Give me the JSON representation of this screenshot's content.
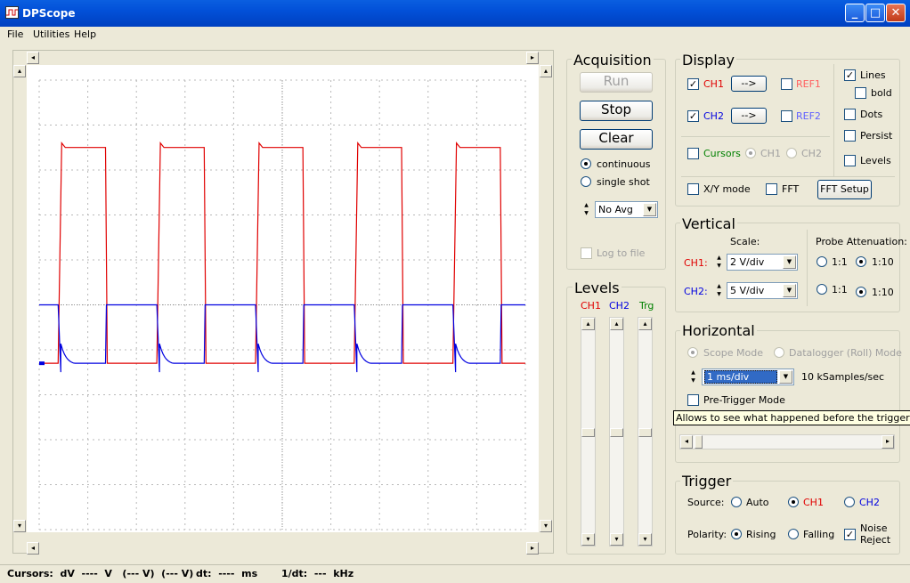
{
  "window": {
    "title": "DPScope",
    "min": "_",
    "max": "□",
    "close": "✕"
  },
  "menu": [
    "File",
    "Utilities",
    "Help"
  ],
  "acquisition": {
    "title": "Acquisition",
    "run": "Run",
    "stop": "Stop",
    "clear": "Clear",
    "continuous": "continuous",
    "single_shot": "single shot",
    "avg": "No Avg",
    "log": "Log to file"
  },
  "display": {
    "title": "Display",
    "ch1": "CH1",
    "ch2": "CH2",
    "ref1": "REF1",
    "ref2": "REF2",
    "arrow": "-->",
    "cursors": "Cursors",
    "cur_ch1": "CH1",
    "cur_ch2": "CH2",
    "lines": "Lines",
    "bold": "bold",
    "dots": "Dots",
    "persist": "Persist",
    "levels": "Levels",
    "xy": "X/Y mode",
    "fft": "FFT",
    "fft_setup": "FFT Setup"
  },
  "vertical": {
    "title": "Vertical",
    "scale": "Scale:",
    "ch1": "CH1:",
    "ch2": "CH2:",
    "ch1_val": "2 V/div",
    "ch2_val": "5 V/div",
    "probe": "Probe Attenuation:",
    "a11": "1:1",
    "a110": "1:10"
  },
  "levels": {
    "title": "Levels",
    "ch1": "CH1",
    "ch2": "CH2",
    "trg": "Trg"
  },
  "horizontal": {
    "title": "Horizontal",
    "scope_mode": "Scope Mode",
    "datalogger": "Datalogger (Roll) Mode",
    "timebase": "1 ms/div",
    "rate": "10 kSamples/sec",
    "pretrigger": "Pre-Trigger Mode",
    "tooltip": "Allows to see what happened before the trigger"
  },
  "trigger": {
    "title": "Trigger",
    "source": "Source:",
    "auto": "Auto",
    "ch1": "CH1",
    "ch2": "CH2",
    "polarity": "Polarity:",
    "rising": "Rising",
    "falling": "Falling",
    "noise1": "Noise",
    "noise2": "Reject"
  },
  "status": {
    "cursors": "Cursors:  dV  ----  V   (--- V)  (--- V)",
    "dt": "dt:  ----  ms",
    "inv": "1/dt:  ---  kHz"
  },
  "colors": {
    "ch1": "#E00000",
    "ch2": "#0000E0",
    "ref1": "#FF6060",
    "ref2": "#6060FF"
  },
  "chart_data": {
    "type": "line",
    "grid": true,
    "x_divisions": 10,
    "y_divisions": 10,
    "timebase": "1 ms/div",
    "series": [
      {
        "name": "CH1",
        "color": "#E00000",
        "scale": "2 V/div",
        "waveform": "square",
        "low_div": -1.3,
        "high_div": 3.6,
        "period_div": 2.03,
        "duty": 0.48
      },
      {
        "name": "CH2",
        "color": "#0000E0",
        "scale": "5 V/div",
        "waveform": "decaying-square",
        "low_div": -1.3,
        "high_div": 0.0,
        "period_div": 2.03
      }
    ]
  }
}
